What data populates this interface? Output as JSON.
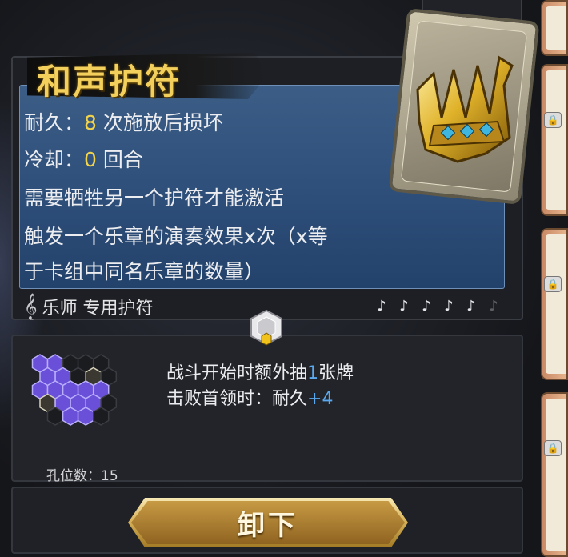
{
  "item": {
    "name": "和声护符",
    "durability_label": "耐久：",
    "durability_value": "8",
    "durability_suffix": " 次施放后损坏",
    "cooldown_label": "冷却：",
    "cooldown_value": "0",
    "cooldown_suffix": " 回合",
    "requirement": "需要牺牲另一个护符才能激活",
    "effect_line1": "触发一个乐章的演奏效果x次（x等",
    "effect_line2": "于卡组中同名乐章的数量）",
    "class_tag": "乐师 专用护符",
    "rarity_filled": 5,
    "rarity_total": 6
  },
  "sockets": {
    "bonus1_prefix": "战斗开始时额外抽",
    "bonus1_value": "1",
    "bonus1_suffix": "张牌",
    "bonus2_prefix": "击败首领时：耐久",
    "bonus2_value": "+4",
    "slot_count_text": "孔位数：15"
  },
  "actions": {
    "unequip_label": "卸下"
  },
  "colors": {
    "title_gold": "#f3cf5c",
    "highlight_yellow": "#f2d34a",
    "highlight_blue": "#5aa9f0",
    "socket_purple": "#6a4fd8"
  }
}
